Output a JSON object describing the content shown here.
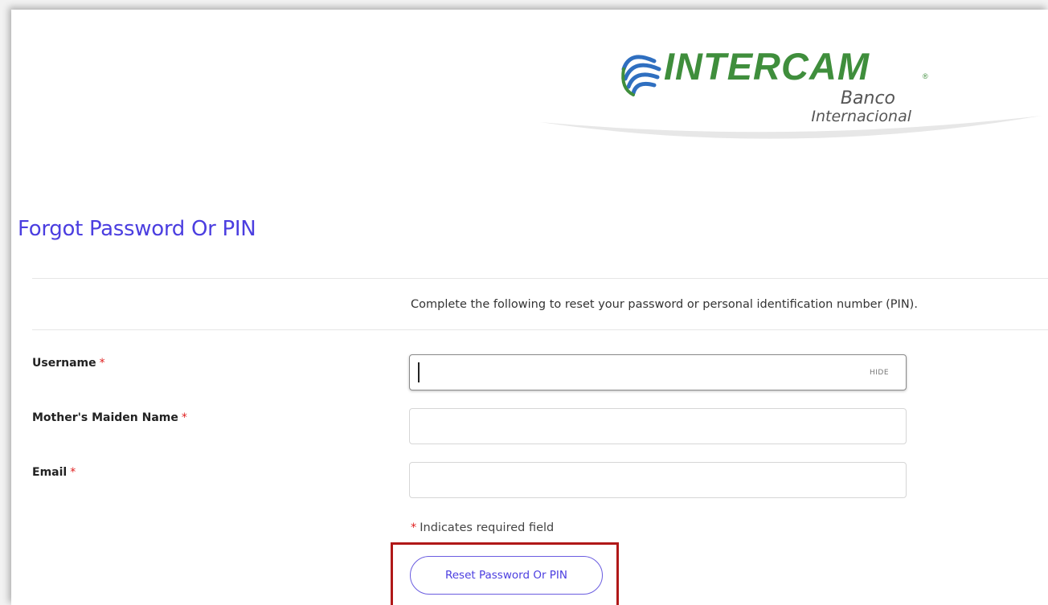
{
  "brand": {
    "name": "INTERCAM",
    "registered_mark": "®",
    "subtitle_line1": "Banco",
    "subtitle_line2": "Internacional",
    "brand_color": "#3f8e3c",
    "logo_icon": "globe-swoosh-icon"
  },
  "page": {
    "title": "Forgot Password Or PIN",
    "title_color": "#4b3ee0",
    "intro_text": "Complete the following to reset your password or personal identification number (PIN)."
  },
  "form": {
    "required_marker": "*",
    "required_color": "#e02020",
    "fields": [
      {
        "label": "Username",
        "value": "",
        "placeholder": "",
        "toggle_label": "HIDE"
      },
      {
        "label": "Mother's Maiden Name",
        "value": "",
        "placeholder": ""
      },
      {
        "label": "Email",
        "value": "",
        "placeholder": ""
      }
    ],
    "required_note": "Indicates required field",
    "submit_label": "Reset Password Or PIN",
    "highlight_color": "#b01818"
  }
}
